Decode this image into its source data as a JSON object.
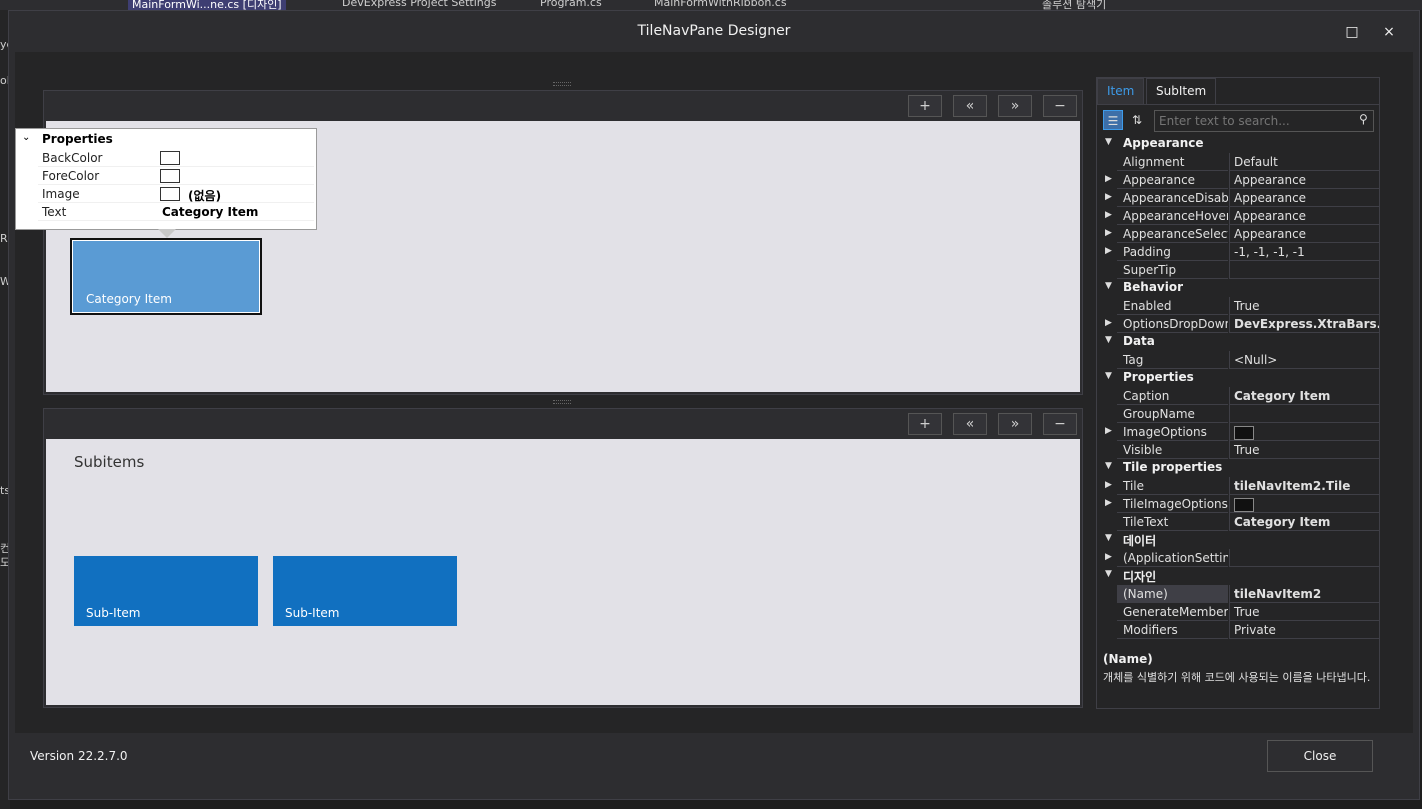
{
  "ide": {
    "tabs": [
      {
        "label": "MainFormWi...ne.cs [디자인]"
      },
      {
        "label": "DevExpress Project Settings"
      },
      {
        "label": "Program.cs"
      },
      {
        "label": "MainFormWithRibbon.cs"
      },
      {
        "label": "솔루션 탐색기"
      }
    ],
    "left_chars": [
      "yc",
      "ols",
      "R",
      "W",
      "ts",
      "컨",
      "도"
    ]
  },
  "dialog": {
    "title": "TileNavPane Designer",
    "maximize_icon": "maximize-icon",
    "close_icon": "close-icon",
    "maximize_glyph": "□",
    "close_glyph": "×"
  },
  "toolbar": {
    "add": "+",
    "move_left": "«",
    "move_right": "»",
    "remove": "−"
  },
  "category_panel": {
    "tile_label": "Category Item"
  },
  "popup": {
    "header": "Properties",
    "rows": [
      {
        "name": "BackColor",
        "value": ""
      },
      {
        "name": "ForeColor",
        "value": ""
      },
      {
        "name": "Image",
        "value": "(없음)"
      },
      {
        "name": "Text",
        "value": "Category Item"
      }
    ]
  },
  "subitems_panel": {
    "title": "Subitems",
    "tiles": [
      {
        "label": "Sub-Item"
      },
      {
        "label": "Sub-Item"
      }
    ]
  },
  "property_grid": {
    "tabs": [
      {
        "label": "Item"
      },
      {
        "label": "SubItem"
      }
    ],
    "active_tab": "Item",
    "search_placeholder": "Enter text to search...",
    "rows": [
      {
        "kind": "category",
        "name": "Appearance"
      },
      {
        "kind": "prop",
        "name": "Alignment",
        "value": "Default"
      },
      {
        "kind": "prop",
        "name": "Appearance",
        "value": "Appearance",
        "expandable": true
      },
      {
        "kind": "prop",
        "name": "AppearanceDisabled",
        "value": "Appearance",
        "expandable": true
      },
      {
        "kind": "prop",
        "name": "AppearanceHovered",
        "value": "Appearance",
        "expandable": true
      },
      {
        "kind": "prop",
        "name": "AppearanceSelected",
        "value": "Appearance",
        "expandable": true
      },
      {
        "kind": "prop",
        "name": "Padding",
        "value": "-1, -1, -1, -1",
        "expandable": true
      },
      {
        "kind": "prop",
        "name": "SuperTip",
        "value": ""
      },
      {
        "kind": "category",
        "name": "Behavior"
      },
      {
        "kind": "prop",
        "name": "Enabled",
        "value": "True"
      },
      {
        "kind": "prop",
        "name": "OptionsDropDown",
        "value": "DevExpress.XtraBars.Nav",
        "expandable": true,
        "bold": true
      },
      {
        "kind": "category",
        "name": "Data"
      },
      {
        "kind": "prop",
        "name": "Tag",
        "value": "<Null>"
      },
      {
        "kind": "category",
        "name": "Properties"
      },
      {
        "kind": "prop",
        "name": "Caption",
        "value": "Category Item",
        "bold": true
      },
      {
        "kind": "prop",
        "name": "GroupName",
        "value": ""
      },
      {
        "kind": "prop",
        "name": "ImageOptions",
        "value": "",
        "expandable": true,
        "swatch": true
      },
      {
        "kind": "prop",
        "name": "Visible",
        "value": "True"
      },
      {
        "kind": "category",
        "name": "Tile properties"
      },
      {
        "kind": "prop",
        "name": "Tile",
        "value": "tileNavItem2.Tile",
        "expandable": true,
        "bold": true
      },
      {
        "kind": "prop",
        "name": "TileImageOptions",
        "value": "",
        "expandable": true,
        "swatch": true
      },
      {
        "kind": "prop",
        "name": "TileText",
        "value": "Category Item",
        "bold": true
      },
      {
        "kind": "category",
        "name": "데이터"
      },
      {
        "kind": "prop",
        "name": "(ApplicationSettings)",
        "value": "",
        "expandable": true
      },
      {
        "kind": "category",
        "name": "디자인"
      },
      {
        "kind": "prop",
        "name": "(Name)",
        "value": "tileNavItem2",
        "bold": true,
        "selected": true
      },
      {
        "kind": "prop",
        "name": "GenerateMember",
        "value": "True"
      },
      {
        "kind": "prop",
        "name": "Modifiers",
        "value": "Private"
      }
    ],
    "description": {
      "title": "(Name)",
      "text": "개체를 식별하기 위해 코드에 사용되는 이름을 나타냅니다."
    }
  },
  "footer": {
    "version": "Version 22.2.7.0",
    "close_label": "Close"
  }
}
